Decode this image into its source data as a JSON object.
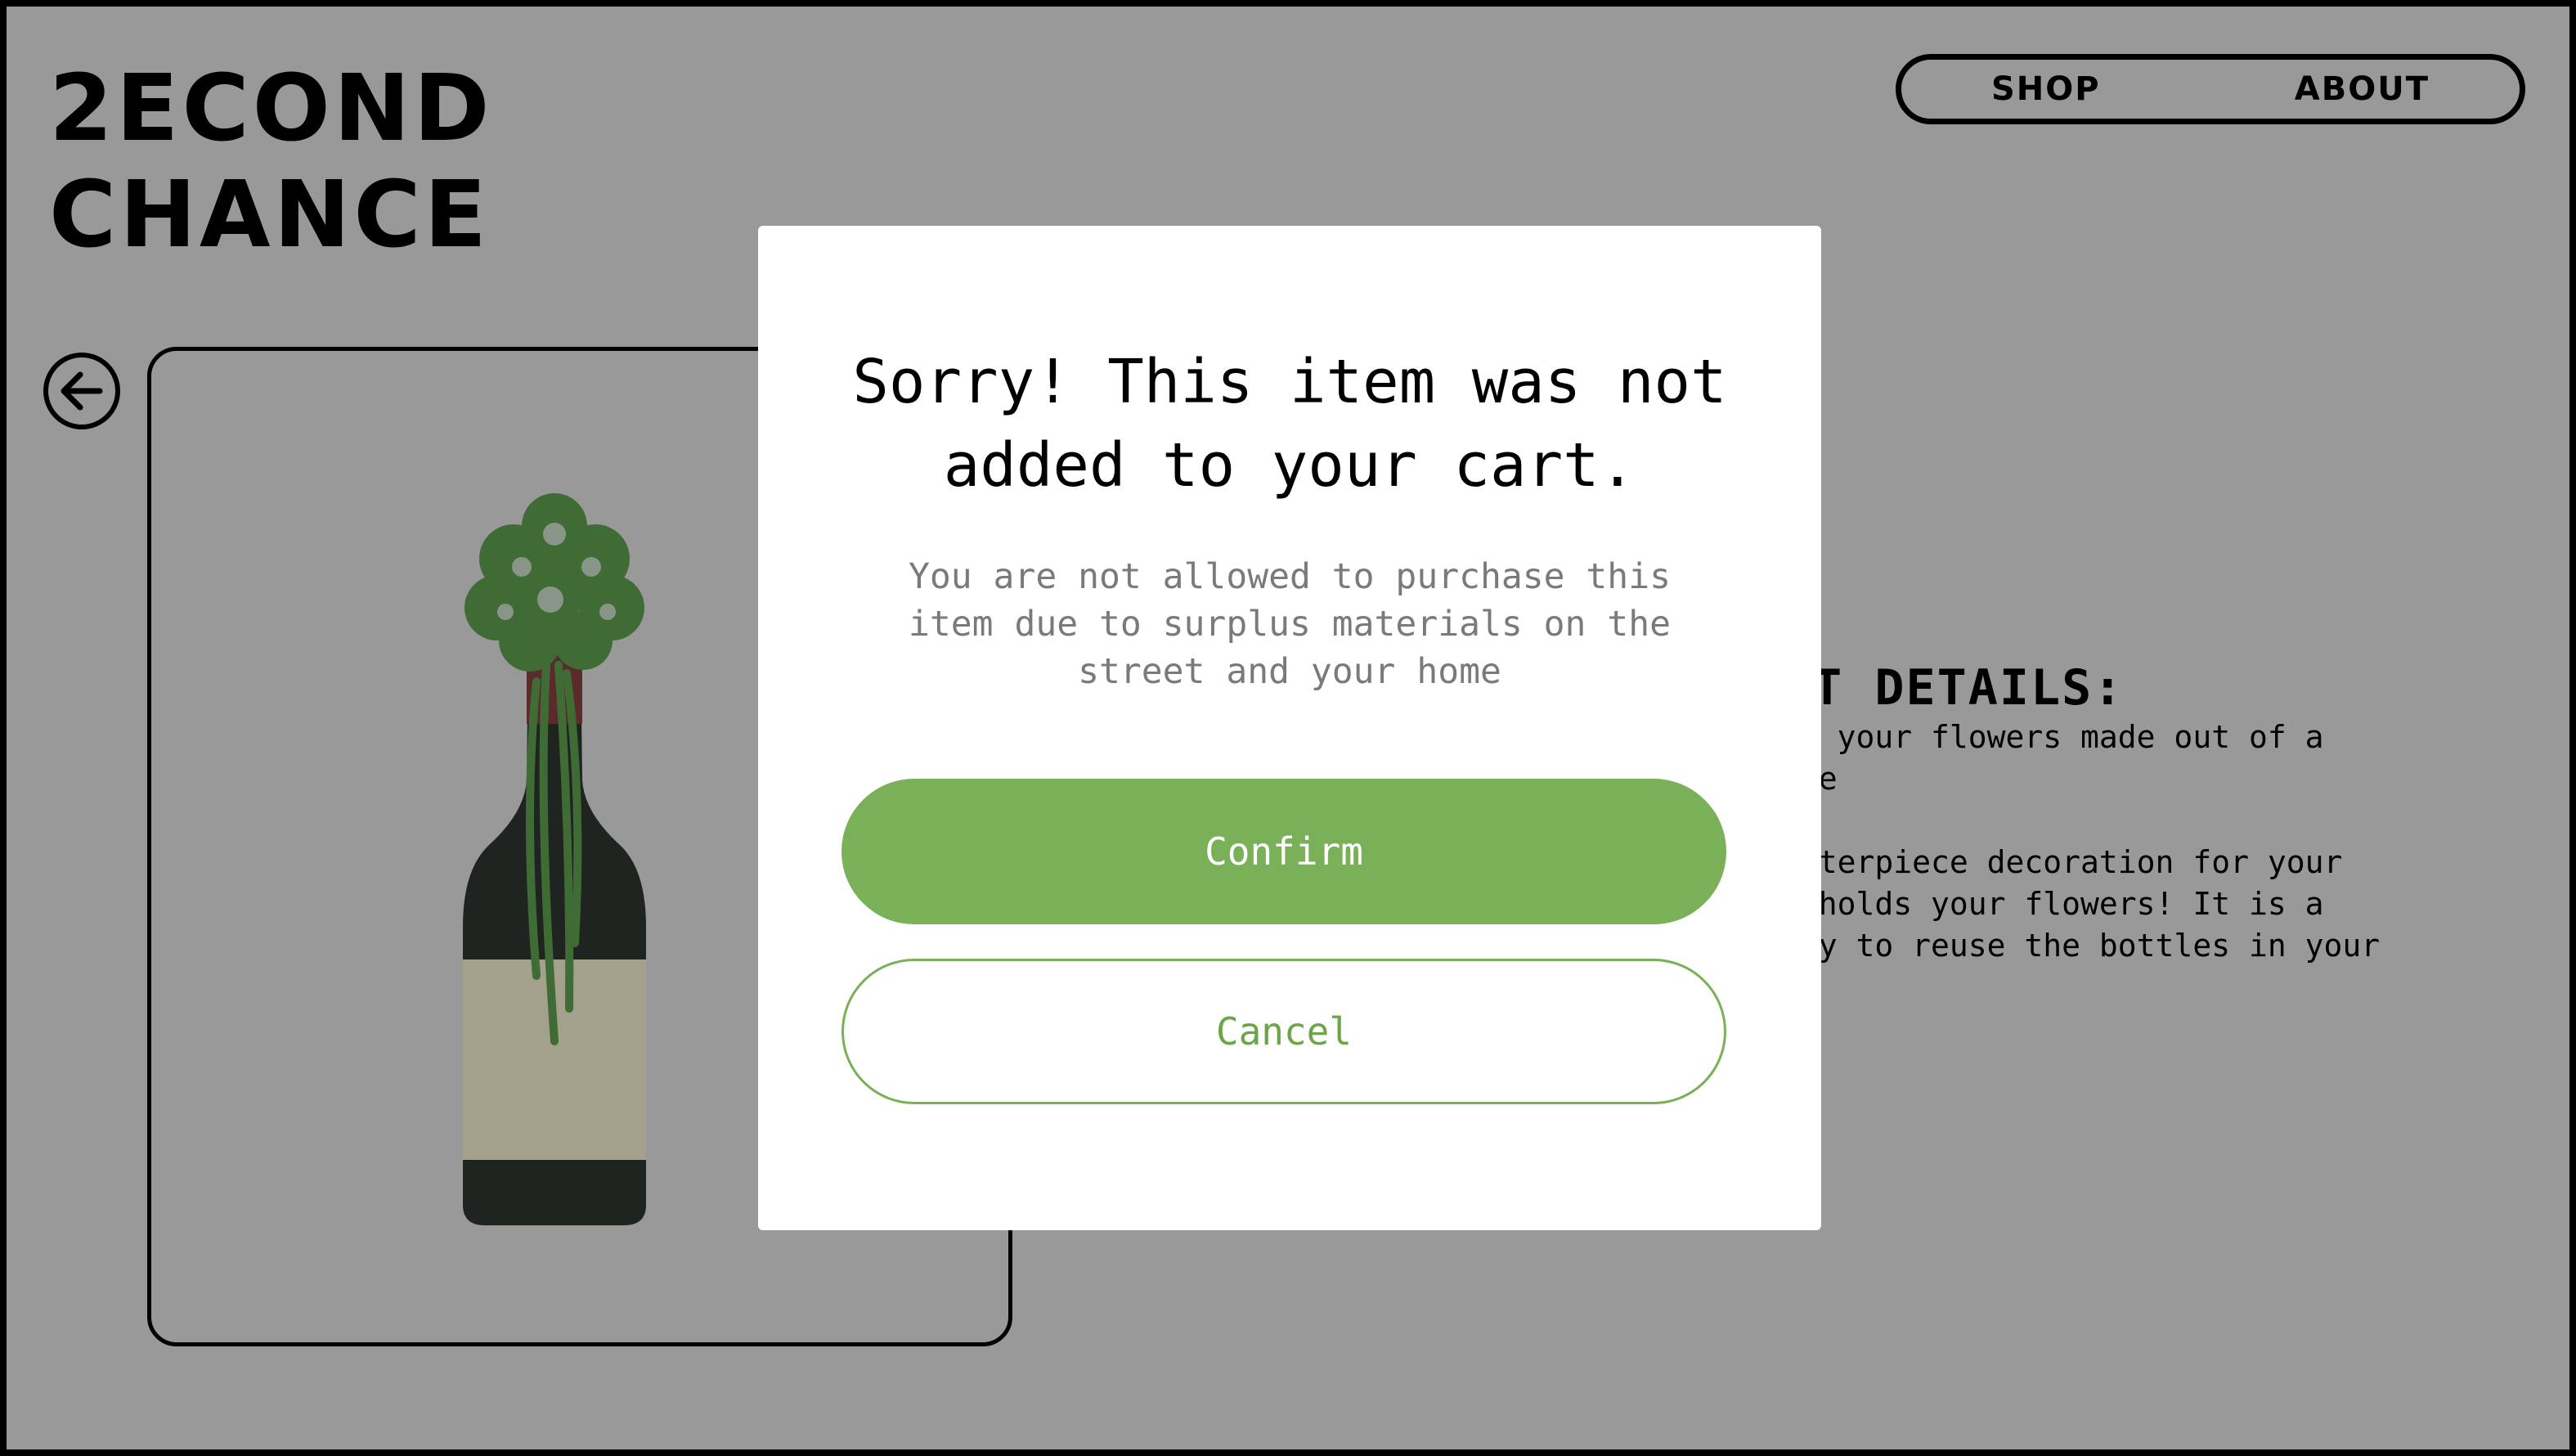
{
  "brand": {
    "line1": "2ECOND",
    "line2": "CHANCE"
  },
  "nav": {
    "shop": "SHOP",
    "about": "ABOUT"
  },
  "icons": {
    "back": "arrow-left-circle-icon"
  },
  "details": {
    "heading": "CT DETAILS:",
    "line1": "or your flowers made out of a\ntle",
    "line2": "enterpiece decoration for your\nt holds your flowers! It is a\nway to reuse the bottles in your"
  },
  "modal": {
    "title": "Sorry! This item was not added to your cart.",
    "body": "You are not allowed to purchase this item due to surplus materials on the street and your home",
    "confirm": "Confirm",
    "cancel": "Cancel"
  },
  "colors": {
    "background": "#999999",
    "accent": "#7ab057",
    "modal": "#ffffff"
  }
}
